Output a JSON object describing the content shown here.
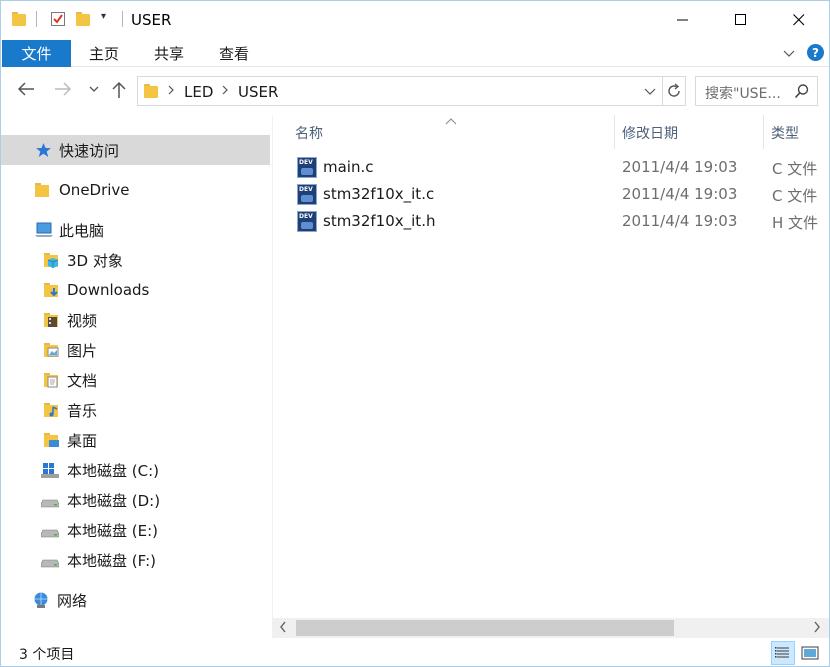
{
  "window": {
    "title": "USER"
  },
  "ribbon": {
    "tabs": [
      "文件",
      "主页",
      "共享",
      "查看"
    ]
  },
  "address": {
    "path": [
      "LED",
      "USER"
    ],
    "search_placeholder": "搜索\"USE..."
  },
  "sidebar": {
    "quick_access": "快速访问",
    "onedrive": "OneDrive",
    "this_pc": "此电脑",
    "items": [
      "3D 对象",
      "Downloads",
      "视频",
      "图片",
      "文档",
      "音乐",
      "桌面",
      "本地磁盘 (C:)",
      "本地磁盘 (D:)",
      "本地磁盘 (E:)",
      "本地磁盘 (F:)"
    ],
    "network": "网络"
  },
  "columns": {
    "name": "名称",
    "date": "修改日期",
    "type": "类型"
  },
  "files": [
    {
      "name": "main.c",
      "date": "2011/4/4 19:03",
      "type": "C 文件"
    },
    {
      "name": "stm32f10x_it.c",
      "date": "2011/4/4 19:03",
      "type": "C 文件"
    },
    {
      "name": "stm32f10x_it.h",
      "date": "2011/4/4 19:03",
      "type": "H 文件"
    }
  ],
  "file_icon_text": "DEV",
  "status": {
    "count": "3 个项目"
  },
  "colors": {
    "accent": "#1979ca",
    "selection": "#d9d9d9",
    "column_header": "#4c607a"
  }
}
